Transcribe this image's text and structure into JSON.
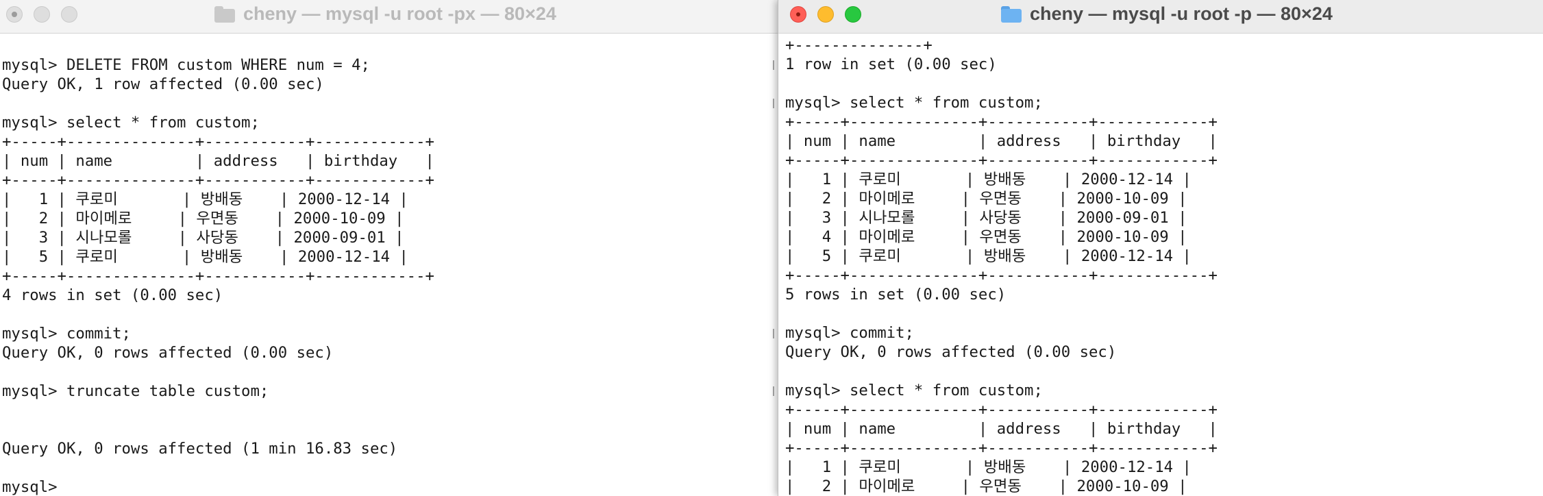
{
  "left_window": {
    "title": "cheny — mysql -u root -px — 80×24",
    "lines": [
      "",
      "mysql> DELETE FROM custom WHERE num = 4;",
      "Query OK, 1 row affected (0.00 sec)",
      "",
      "mysql> select * from custom;",
      "+-----+--------------+-----------+------------+",
      "| num | name         | address   | birthday   |",
      "+-----+--------------+-----------+------------+",
      "|   1 | 쿠로미       | 방배동    | 2000-12-14 |",
      "|   2 | 마이메로     | 우면동    | 2000-10-09 |",
      "|   3 | 시나모롤     | 사당동    | 2000-09-01 |",
      "|   5 | 쿠로미       | 방배동    | 2000-12-14 |",
      "+-----+--------------+-----------+------------+",
      "4 rows in set (0.00 sec)",
      "",
      "mysql> commit;",
      "Query OK, 0 rows affected (0.00 sec)",
      "",
      "mysql> truncate table custom;",
      "",
      "",
      "Query OK, 0 rows affected (1 min 16.83 sec)",
      "",
      "mysql> "
    ]
  },
  "right_window": {
    "title": "cheny — mysql -u root -p — 80×24",
    "lines": [
      "+--------------+",
      "1 row in set (0.00 sec)",
      "",
      "mysql> select * from custom;",
      "+-----+--------------+-----------+------------+",
      "| num | name         | address   | birthday   |",
      "+-----+--------------+-----------+------------+",
      "|   1 | 쿠로미       | 방배동    | 2000-12-14 |",
      "|   2 | 마이메로     | 우면동    | 2000-10-09 |",
      "|   3 | 시나모롤     | 사당동    | 2000-09-01 |",
      "|   4 | 마이메로     | 우면동    | 2000-10-09 |",
      "|   5 | 쿠로미       | 방배동    | 2000-12-14 |",
      "+-----+--------------+-----------+------------+",
      "5 rows in set (0.00 sec)",
      "",
      "mysql> commit;",
      "Query OK, 0 rows affected (0.00 sec)",
      "",
      "mysql> select * from custom;",
      "+-----+--------------+-----------+------------+",
      "| num | name         | address   | birthday   |",
      "+-----+--------------+-----------+------------+",
      "|   1 | 쿠로미       | 방배동    | 2000-12-14 |",
      "|   2 | 마이메로     | 우면동    | 2000-10-09 |"
    ]
  },
  "colors": {
    "close": "#ff5f57",
    "minimize": "#febc2e",
    "zoom": "#28c840",
    "titlebar": "#ececec",
    "terminal_bg": "#ffffff",
    "terminal_text": "#1a1a1a"
  },
  "icons": {
    "traffic_lights": [
      "close-icon",
      "minimize-icon",
      "zoom-icon"
    ],
    "title_icon": "folder-icon"
  }
}
